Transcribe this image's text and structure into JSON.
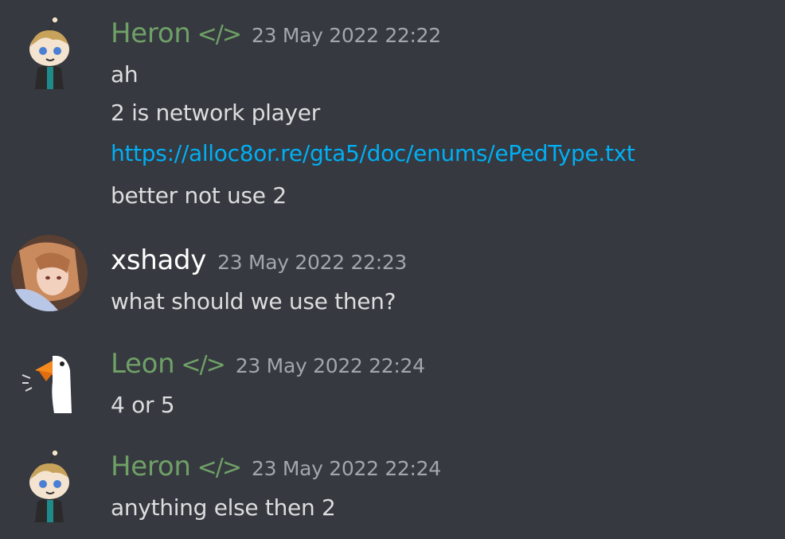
{
  "colors": {
    "background": "#36393f",
    "green_role": "#6fa067",
    "white_name": "#ffffff",
    "timestamp": "#a3a6aa",
    "text": "#dcddde",
    "link": "#00aff4"
  },
  "messages": [
    {
      "username": "Heron",
      "tag": "</>",
      "timestamp": "23 May 2022 22:22",
      "avatar_icon": "reddit-snoo-avatar-icon",
      "lines": [
        "ah",
        "2 is network player",
        "https://alloc8or.re/gta5/doc/enums/ePedType.txt",
        "better not use 2"
      ]
    },
    {
      "username": "xshady",
      "timestamp": "23 May 2022 22:23",
      "avatar_icon": "anime-girl-avatar-icon",
      "lines": [
        "what should we use then?"
      ]
    },
    {
      "username": "Leon",
      "tag": "</>",
      "timestamp": "23 May 2022 22:24",
      "avatar_icon": "goose-avatar-icon",
      "lines": [
        "4 or 5"
      ]
    },
    {
      "username": "Heron",
      "tag": "</>",
      "timestamp": "23 May 2022 22:24",
      "avatar_icon": "reddit-snoo-avatar-icon",
      "lines": [
        "anything else then 2"
      ]
    }
  ]
}
